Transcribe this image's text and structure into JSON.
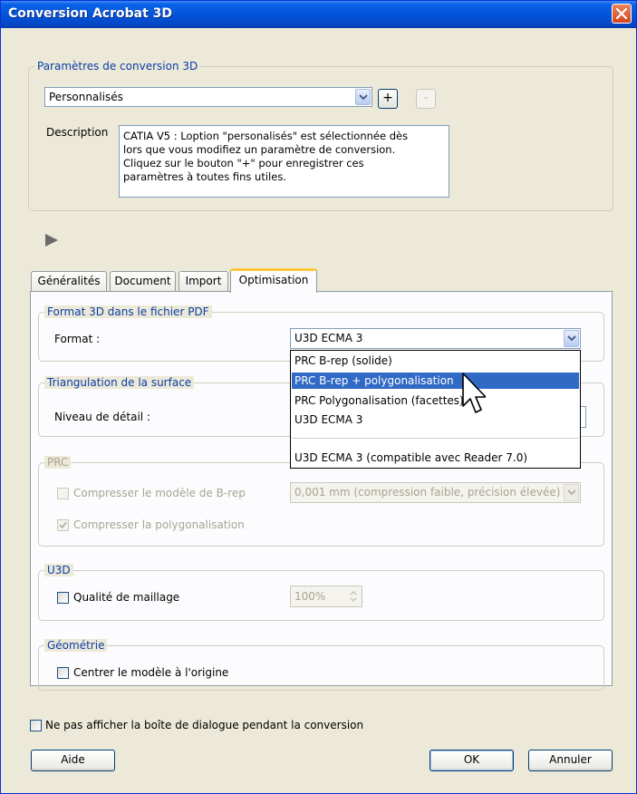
{
  "window": {
    "title": "Conversion Acrobat 3D"
  },
  "conversion": {
    "legend": "Paramètres de conversion 3D",
    "preset_value": "Personnalisés",
    "add_label": "+",
    "remove_label": "-",
    "description_label": "Description",
    "description_lines": [
      "CATIA V5 : Loption \"personalisés\" est sélectionnée dès",
      "lors que vous modifiez un paramètre de conversion.",
      "Cliquez sur le bouton \"+\" pour enregistrer ces",
      "paramètres à toutes fins utiles."
    ]
  },
  "tabs": [
    "Généralités",
    "Document",
    "Import",
    "Optimisation"
  ],
  "format_group": {
    "legend": "Format 3D dans le fichier PDF",
    "format_label": "Format :",
    "format_value": "U3D ECMA 3",
    "options": [
      "PRC B-rep (solide)",
      "PRC B-rep + polygonalisation",
      "PRC Polygonalisation (facettes)",
      "U3D ECMA 3",
      "U3D ECMA 3 (compatible avec Reader 7.0)"
    ],
    "selected_index": 1
  },
  "triangulation": {
    "legend": "Triangulation de la surface",
    "level_label": "Niveau de détail :"
  },
  "prc": {
    "legend": "PRC",
    "compress_brep_label": "Compresser le modèle de B-rep",
    "compress_brep_value": "0,001 mm (compression faible, précision élevée)",
    "compress_poly_label": "Compresser la polygonalisation",
    "compress_brep_checked": false,
    "compress_poly_checked": true
  },
  "u3d": {
    "legend": "U3D",
    "mesh_label": "Qualité de maillage",
    "mesh_value": "100%",
    "mesh_checked": false
  },
  "geometry": {
    "legend": "Géométrie",
    "center_label": "Centrer le modèle à l'origine",
    "center_checked": false
  },
  "footer": {
    "no_dialog_label": "Ne pas afficher la boîte de dialogue pendant la conversion",
    "no_dialog_checked": false,
    "help_label": "Aide",
    "ok_label": "OK",
    "cancel_label": "Annuler"
  },
  "colors": {
    "title_bar": "#0454d8",
    "legend_text": "#0a3ea8",
    "selection": "#316ac5",
    "active_tab_accent": "#ffc83c"
  }
}
